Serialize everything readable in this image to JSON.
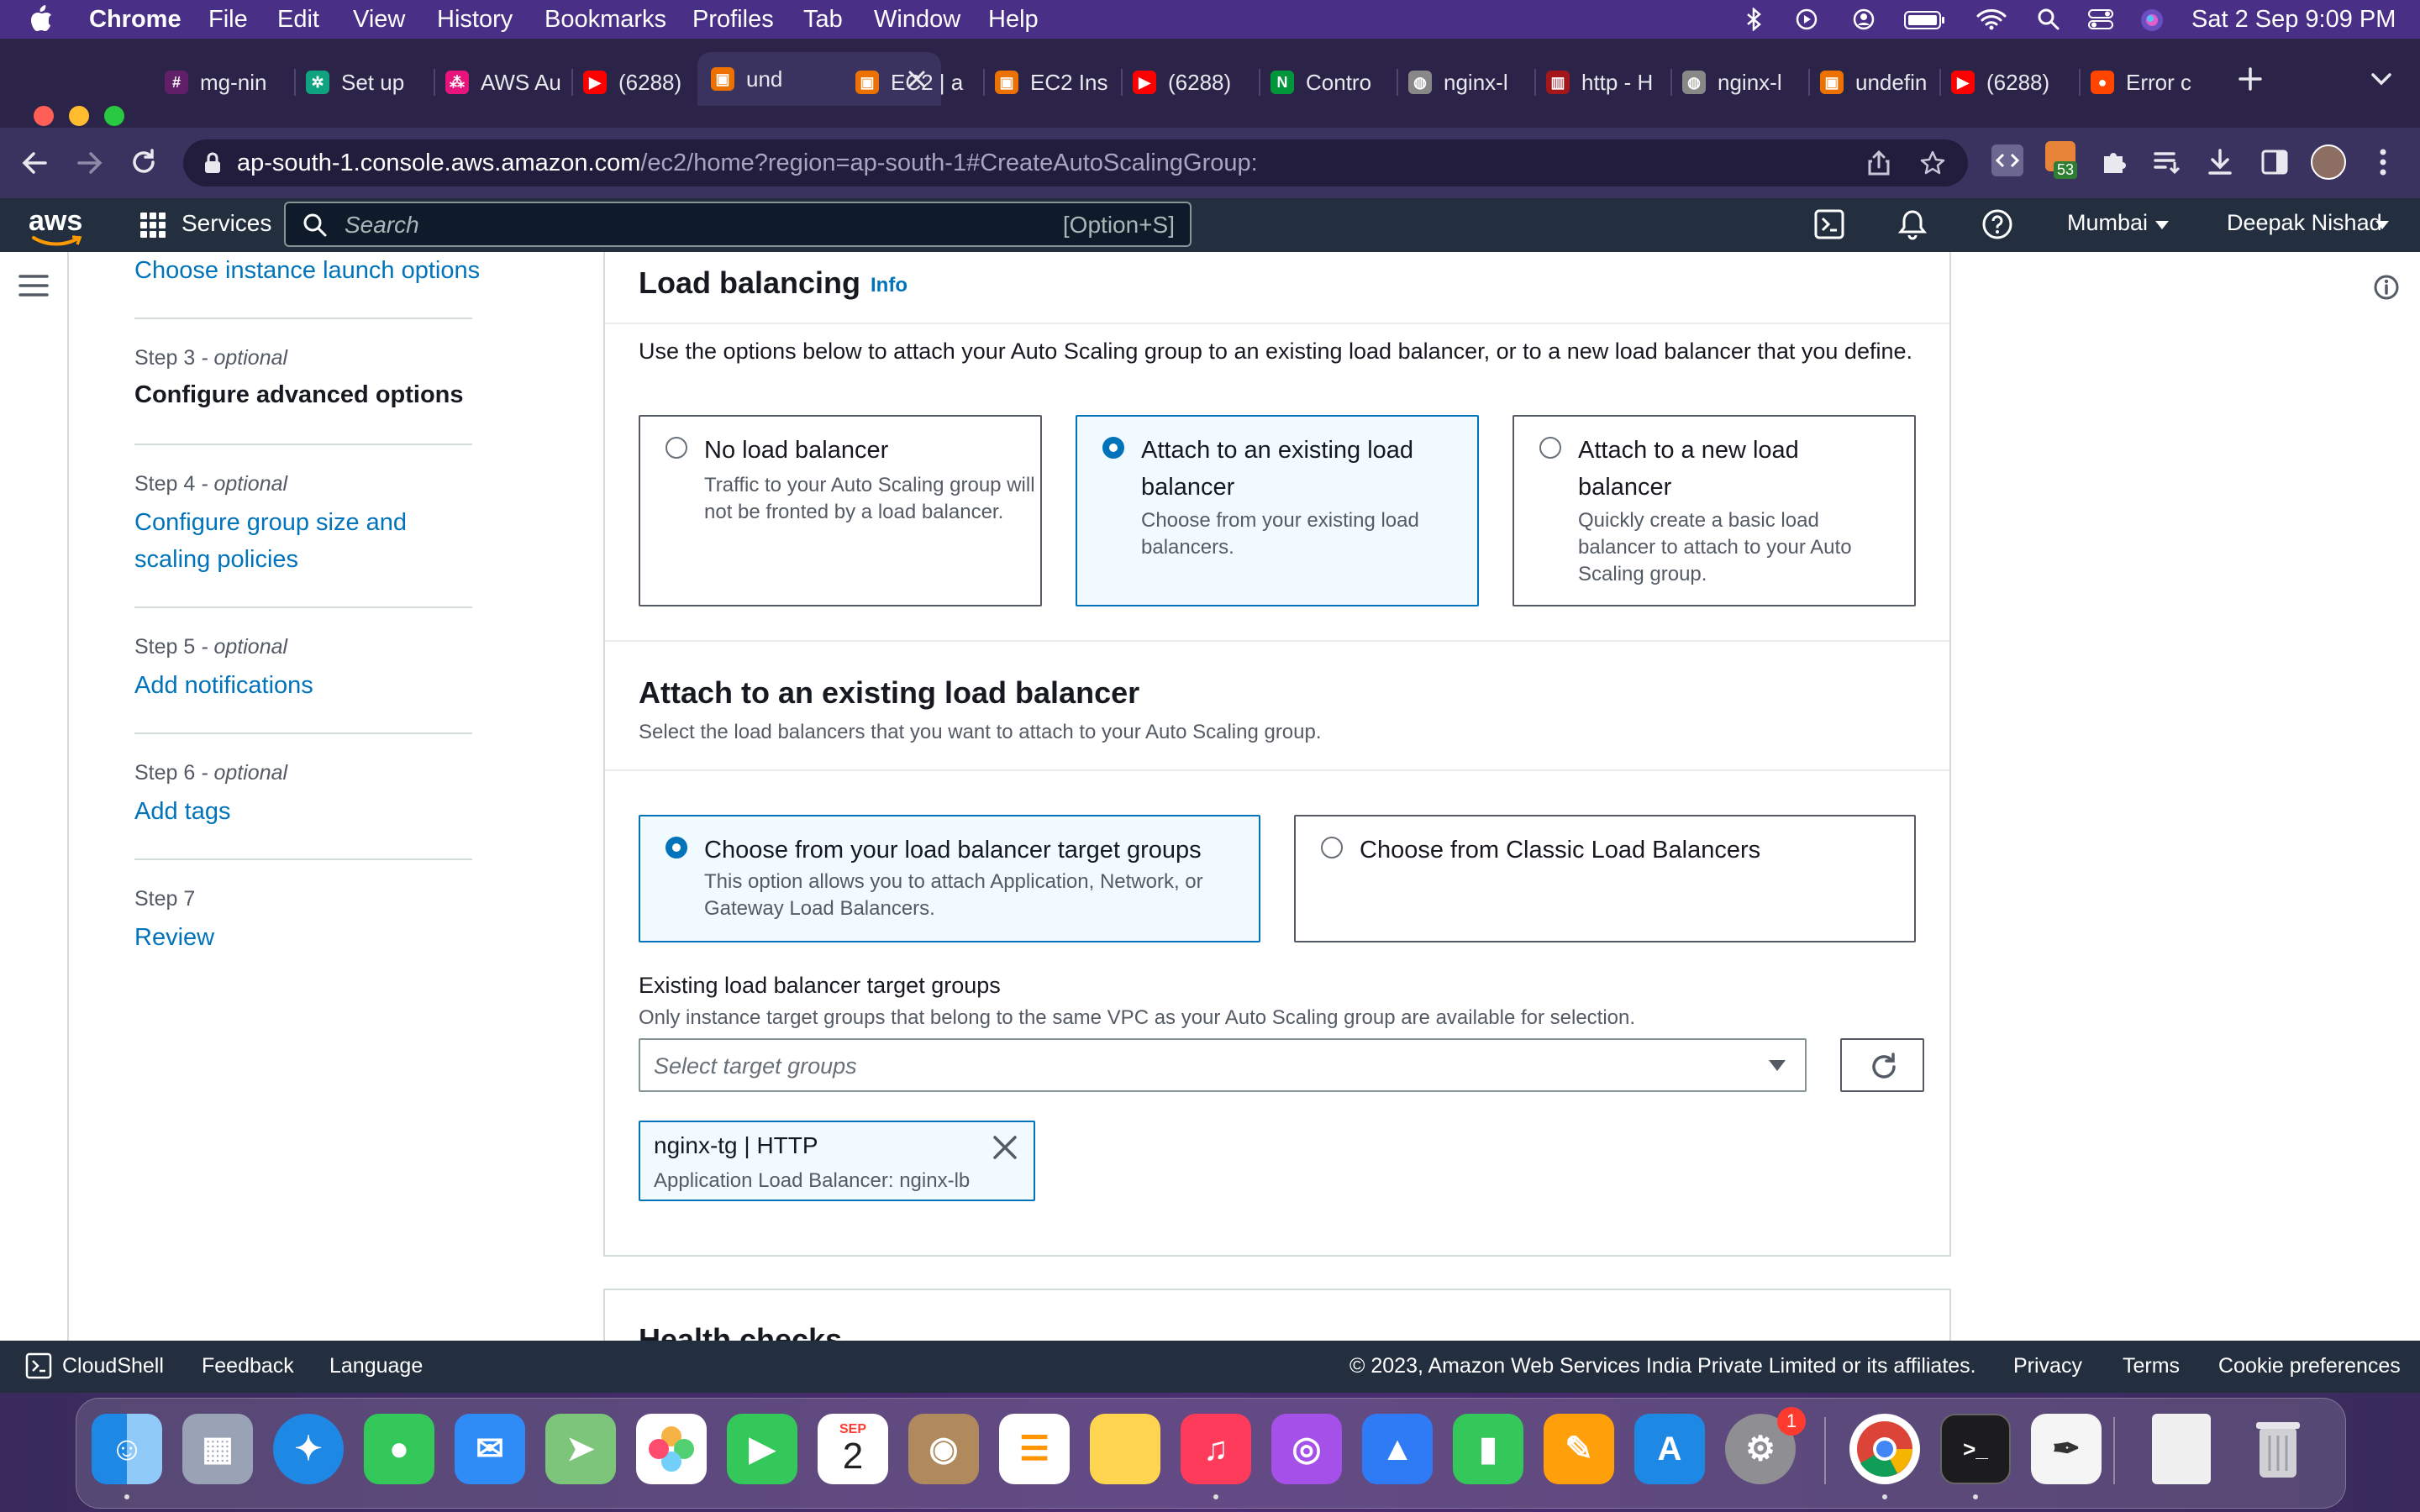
{
  "macos": {
    "app_name": "Chrome",
    "menus": [
      "File",
      "Edit",
      "View",
      "History",
      "Bookmarks",
      "Profiles",
      "Tab",
      "Window",
      "Help"
    ],
    "clock": "Sat 2 Sep  9:09 PM"
  },
  "tabs": [
    {
      "title": "mg-nin",
      "icon": "slack-icon",
      "color": "#611f69"
    },
    {
      "title": "Set up",
      "icon": "chatgpt-icon",
      "color": "#10a37f"
    },
    {
      "title": "AWS Au",
      "icon": "aws-icon",
      "color": "#e7157b"
    },
    {
      "title": "(6288)",
      "icon": "youtube-icon",
      "color": "#ff0000"
    },
    {
      "title": "und",
      "icon": "aws-ec2-icon",
      "color": "#ed7100",
      "active": true
    },
    {
      "title": "EC2 | a",
      "icon": "aws-ec2-icon",
      "color": "#ed7100"
    },
    {
      "title": "EC2 Ins",
      "icon": "aws-ec2-icon",
      "color": "#ed7100"
    },
    {
      "title": "(6288)",
      "icon": "youtube-icon",
      "color": "#ff0000"
    },
    {
      "title": "Contro",
      "icon": "nginx-icon",
      "color": "#009639"
    },
    {
      "title": "nginx-l",
      "icon": "globe-icon",
      "color": "#888888"
    },
    {
      "title": "http - H",
      "icon": "bars-icon",
      "color": "#a4161a"
    },
    {
      "title": "nginx-l",
      "icon": "globe-icon",
      "color": "#888888"
    },
    {
      "title": "undefin",
      "icon": "aws-ec2-icon",
      "color": "#ed7100"
    },
    {
      "title": "(6288)",
      "icon": "youtube-icon",
      "color": "#ff0000"
    },
    {
      "title": "Error c",
      "icon": "reddit-icon",
      "color": "#ff4500"
    }
  ],
  "address_bar": {
    "host": "ap-south-1.console.aws.amazon.com",
    "path": "/ec2/home?region=ap-south-1#CreateAutoScalingGroup:"
  },
  "extension_badge": "53",
  "aws_nav": {
    "logo": "aws",
    "services": "Services",
    "search_placeholder": "Search",
    "search_shortcut": "[Option+S]",
    "region": "Mumbai",
    "user": "Deepak Nishad"
  },
  "steps": {
    "top_link": "Choose instance launch options",
    "step3_caption": "Step 3",
    "step3_optional": " - optional",
    "step3_title": "Configure advanced options",
    "step4_caption": "Step 4",
    "step4_optional": " - optional",
    "step4_title": "Configure group size and scaling policies",
    "step5_caption": "Step 5",
    "step5_optional": " - optional",
    "step5_title": "Add notifications",
    "step6_caption": "Step 6",
    "step6_optional": " - optional",
    "step6_title": "Add tags",
    "step7_caption": "Step 7",
    "step7_title": "Review"
  },
  "load_balancing": {
    "title": "Load balancing",
    "info": "Info",
    "description": "Use the options below to attach your Auto Scaling group to an existing load balancer, or to a new load balancer that you define.",
    "options": [
      {
        "title": "No load balancer",
        "desc": "Traffic to your Auto Scaling group will not be fronted by a load balancer.",
        "selected": false
      },
      {
        "title": "Attach to an existing load balancer",
        "desc": "Choose from your existing load balancers.",
        "selected": true
      },
      {
        "title": "Attach to a new load balancer",
        "desc": "Quickly create a basic load balancer to attach to your Auto Scaling group.",
        "selected": false
      }
    ]
  },
  "attach_existing": {
    "title": "Attach to an existing load balancer",
    "description": "Select the load balancers that you want to attach to your Auto Scaling group.",
    "options": [
      {
        "title": "Choose from your load balancer target groups",
        "desc": "This option allows you to attach Application, Network, or Gateway Load Balancers.",
        "selected": true
      },
      {
        "title": "Choose from Classic Load Balancers",
        "desc": "",
        "selected": false
      }
    ],
    "field_label": "Existing load balancer target groups",
    "field_hint": "Only instance target groups that belong to the same VPC as your Auto Scaling group are available for selection.",
    "select_placeholder": "Select target groups",
    "token_title": "nginx-tg | HTTP",
    "token_subtitle": "Application Load Balancer: nginx-lb"
  },
  "health_checks": {
    "title": "Health checks"
  },
  "footer": {
    "cloudshell": "CloudShell",
    "feedback": "Feedback",
    "language": "Language",
    "copyright": "© 2023, Amazon Web Services India Private Limited or its affiliates.",
    "privacy": "Privacy",
    "terms": "Terms",
    "cookies": "Cookie preferences"
  },
  "dock": {
    "calendar_month": "SEP",
    "calendar_day": "2",
    "settings_badge": "1",
    "apps": [
      "finder-icon",
      "launchpad-icon",
      "safari-icon",
      "messages-icon",
      "mail-icon",
      "maps-icon",
      "photos-icon",
      "facetime-icon",
      "calendar-icon",
      "contacts-icon",
      "reminders-icon",
      "notes-icon",
      "music-icon",
      "podcasts-icon",
      "keynote-icon",
      "numbers-icon",
      "pages-icon",
      "app-store-icon",
      "system-settings-icon",
      "chrome-icon",
      "terminal-icon",
      "textedit-icon",
      "document-icon",
      "trash-icon"
    ]
  },
  "colors": {
    "aws_link": "#0073bb",
    "aws_nav_bg": "#232f3e",
    "menubar_bg": "#4a2f86"
  }
}
